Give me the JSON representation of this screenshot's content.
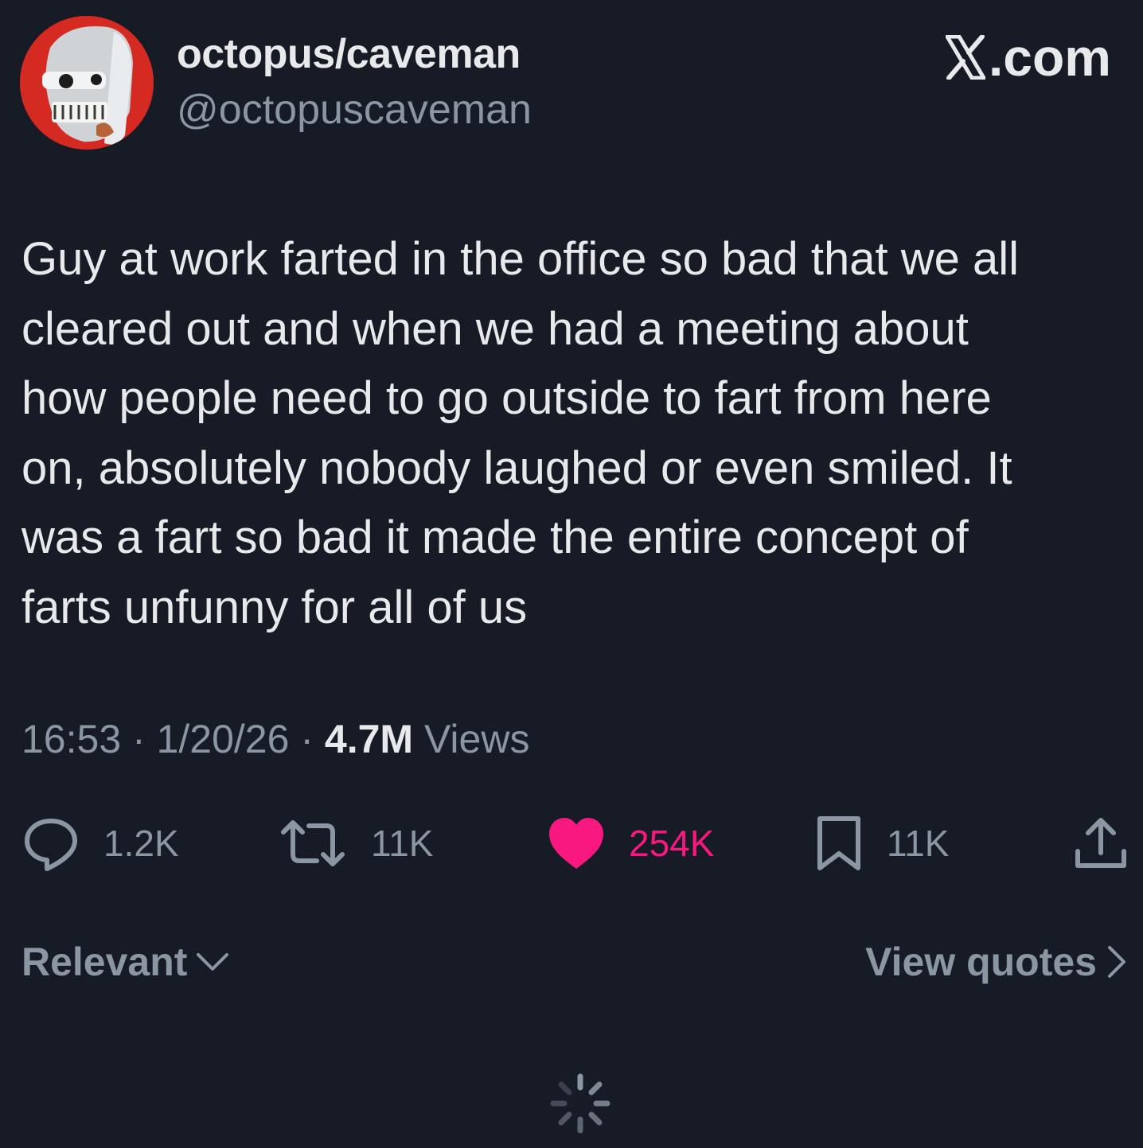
{
  "author": {
    "display_name": "octopus/caveman",
    "handle": "@octopuscaveman",
    "avatar_icon": "skull-face-avatar"
  },
  "brand": {
    "text": ".com",
    "icon": "x-logo-icon"
  },
  "tweet": {
    "text": "Guy at work farted in the office so bad that we all\ncleared out and when we had a meeting about\nhow people need to go outside to fart from here\non, absolutely nobody laughed or even smiled. It\nwas a fart so bad it made the entire concept of\nfarts unfunny for all of us"
  },
  "meta": {
    "time": "16:53",
    "separator": "·",
    "date": "1/20/26",
    "views_count": "4.7M",
    "views_label": "Views"
  },
  "actions": {
    "replies": {
      "icon": "reply-icon",
      "count": "1.2K"
    },
    "reposts": {
      "icon": "repost-icon",
      "count": "11K"
    },
    "likes": {
      "icon": "heart-icon",
      "count": "254K",
      "color": "#f91880"
    },
    "bookmarks": {
      "icon": "bookmark-icon",
      "count": "11K"
    },
    "share": {
      "icon": "share-icon"
    }
  },
  "footer": {
    "sort_label": "Relevant",
    "view_quotes_label": "View quotes"
  },
  "colors": {
    "background": "#161b26",
    "primary_text": "#e7e9ea",
    "secondary_text": "#8b96a3",
    "like": "#f91880"
  }
}
